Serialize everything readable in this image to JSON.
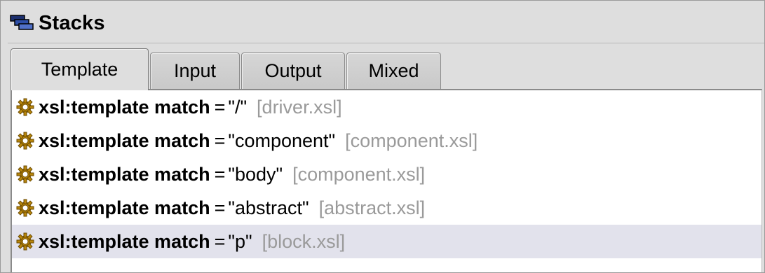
{
  "panel": {
    "title": "Stacks",
    "title_icon": "stacks-icon"
  },
  "tabs": [
    {
      "label": "Template",
      "active": true
    },
    {
      "label": "Input",
      "active": false
    },
    {
      "label": "Output",
      "active": false
    },
    {
      "label": "Mixed",
      "active": false
    }
  ],
  "rows": [
    {
      "icon": "gear-icon",
      "keyword": "xsl:template match",
      "equals": "=",
      "value": "\"/\"",
      "file": "[driver.xsl]",
      "selected": false
    },
    {
      "icon": "gear-icon",
      "keyword": "xsl:template match",
      "equals": "=",
      "value": "\"component\"",
      "file": "[component.xsl]",
      "selected": false
    },
    {
      "icon": "gear-icon",
      "keyword": "xsl:template match",
      "equals": "=",
      "value": "\"body\"",
      "file": "[component.xsl]",
      "selected": false
    },
    {
      "icon": "gear-icon",
      "keyword": "xsl:template match",
      "equals": "=",
      "value": "\"abstract\"",
      "file": "[abstract.xsl]",
      "selected": false
    },
    {
      "icon": "gear-icon",
      "keyword": "xsl:template match",
      "equals": "=",
      "value": "\"p\"",
      "file": "[block.xsl]",
      "selected": true
    }
  ],
  "colors": {
    "gear": "#b8860b",
    "selected_row": "#e2e2ec",
    "file_text": "#9a9a9a"
  }
}
